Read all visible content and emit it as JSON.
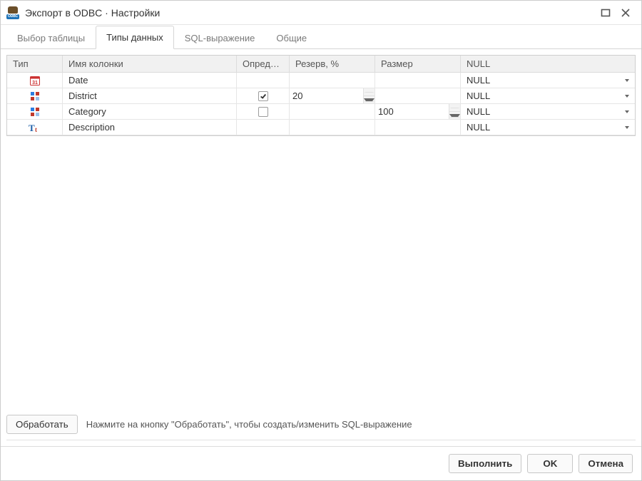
{
  "window": {
    "title": "Экспорт в ODBC · Настройки"
  },
  "tabs": [
    {
      "id": "table-select",
      "label": "Выбор таблицы",
      "active": false
    },
    {
      "id": "data-types",
      "label": "Типы данных",
      "active": true
    },
    {
      "id": "sql-expr",
      "label": "SQL-выражение",
      "active": false
    },
    {
      "id": "general",
      "label": "Общие",
      "active": false
    }
  ],
  "columns": {
    "type": "Тип",
    "name": "Имя колонки",
    "define": "Определ…",
    "reserve": "Резерв, %",
    "size": "Размер",
    "null": "NULL"
  },
  "rows": [
    {
      "icon": "calendar",
      "name": "Date",
      "define": null,
      "reserve": "",
      "has_reserve_spin": false,
      "size": "",
      "has_size_spin": false,
      "null": "NULL"
    },
    {
      "icon": "enum",
      "name": "District",
      "define": true,
      "reserve": "20",
      "has_reserve_spin": true,
      "size": "",
      "has_size_spin": false,
      "null": "NULL"
    },
    {
      "icon": "enum",
      "name": "Category",
      "define": false,
      "reserve": "",
      "has_reserve_spin": false,
      "size": "100",
      "has_size_spin": true,
      "null": "NULL"
    },
    {
      "icon": "text",
      "name": "Description",
      "define": null,
      "reserve": "",
      "has_reserve_spin": false,
      "size": "",
      "has_size_spin": false,
      "null": "NULL"
    }
  ],
  "process": {
    "button": "Обработать",
    "hint": "Нажмите на кнопку \"Обработать\", чтобы создать/изменить SQL-выражение"
  },
  "footer": {
    "execute": "Выполнить",
    "ok": "OK",
    "cancel": "Отмена"
  }
}
